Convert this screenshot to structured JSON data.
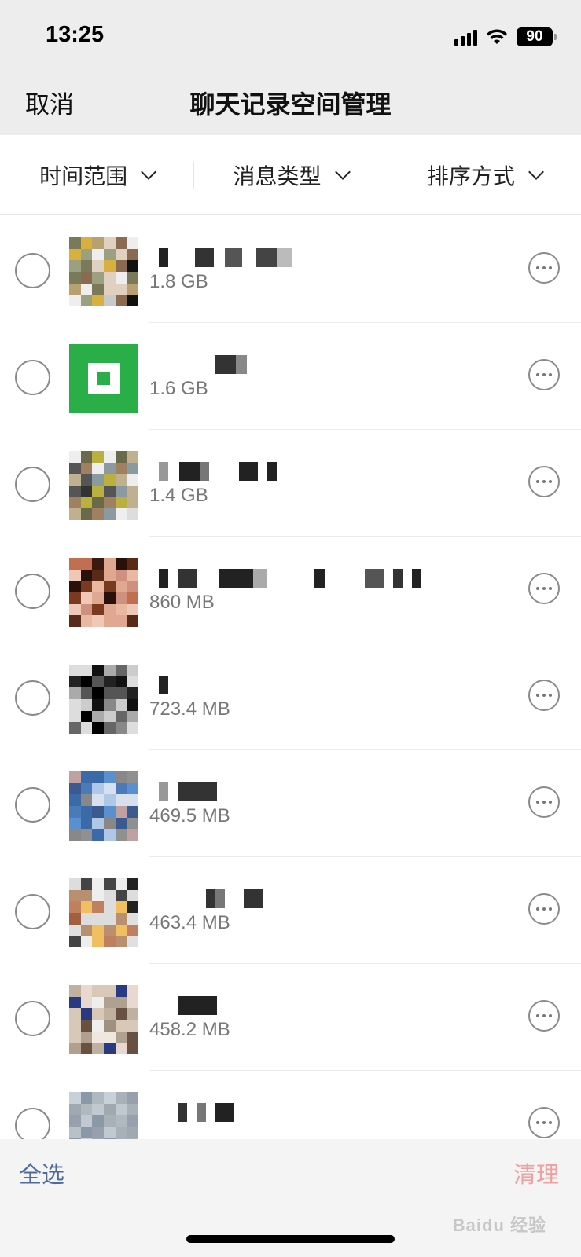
{
  "status_bar": {
    "time": "13:25",
    "battery": "90"
  },
  "nav": {
    "cancel_label": "取消",
    "title": "聊天记录空间管理"
  },
  "filters": [
    {
      "label": "时间范围"
    },
    {
      "label": "消息类型"
    },
    {
      "label": "排序方式"
    }
  ],
  "chats": [
    {
      "size": "1.8 GB"
    },
    {
      "size": "1.6 GB"
    },
    {
      "size": "1.4 GB"
    },
    {
      "size": "860 MB"
    },
    {
      "size": "723.4 MB"
    },
    {
      "size": "469.5 MB"
    },
    {
      "size": "463.4 MB"
    },
    {
      "size": "458.2 MB"
    },
    {
      "size": ""
    }
  ],
  "bottom_bar": {
    "select_all_label": "全选",
    "clean_label": "清理",
    "watermark": "Baidu 经验"
  },
  "colors": {
    "accent_link": "#4e6a9a",
    "clean_disabled": "#f0a0a0",
    "wechat_green": "#2aae48"
  }
}
